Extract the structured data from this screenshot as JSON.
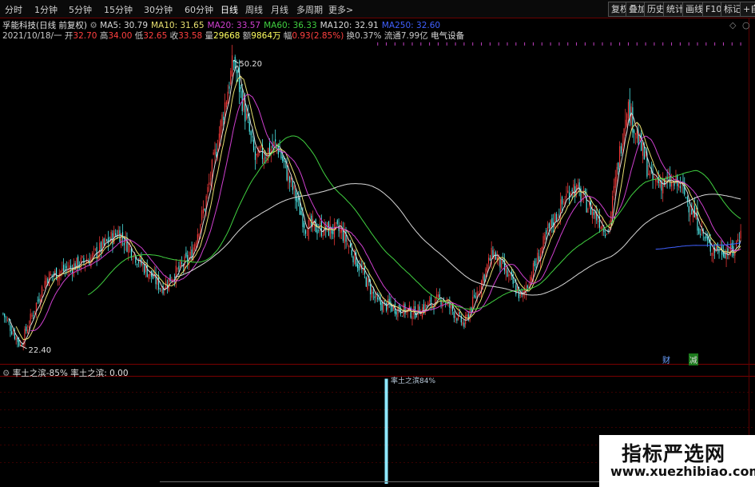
{
  "toolbar": {
    "periods": [
      "分时",
      "1分钟",
      "5分钟",
      "15分钟",
      "30分钟",
      "60分钟",
      "日线",
      "周线",
      "月线",
      "多周期",
      "更多>"
    ],
    "active_period": "日线",
    "right_buttons": [
      "复权",
      "叠加",
      "历史",
      "统计",
      "画线",
      "F10",
      "标记",
      "+自选"
    ]
  },
  "header": {
    "stock_title": "孚能科技(日线 前复权)",
    "ma_labels": [
      "MA5: 30.79",
      "MA10: 31.65",
      "MA20: 33.57",
      "MA60: 36.33",
      "MA120: 32.91",
      "MA250: 32.60"
    ],
    "ma_colors": [
      "#d8d8d8",
      "#e8e070",
      "#d040d0",
      "#40d040",
      "#d8d8d8",
      "#4060ff"
    ],
    "date": "2021/10/18/一",
    "open_label": "开",
    "open": "32.70",
    "high_label": "高",
    "high": "34.00",
    "low_label": "低",
    "low": "32.65",
    "close_label": "收",
    "close": "33.58",
    "volume_label": "量",
    "volume": "29668",
    "amount_label": "额",
    "amount": "9864万",
    "change_label": "幅",
    "change": "0.93(2.85%)",
    "turnover_label": "换",
    "turnover": "0.37%",
    "float_label": "流通",
    "float_cap": "7.99亿",
    "sector": "电气设备"
  },
  "price_annotations": {
    "high_label": "50.20",
    "low_label": "22.40"
  },
  "badges": {
    "cai": "财",
    "jian": "减"
  },
  "sub_chart": {
    "title": "率土之滨-85%",
    "value_label": "率土之滨: 0.00",
    "spike_label": "率土之滨84%"
  },
  "watermark": {
    "cn": "指标严选网",
    "url": "www.xuezhibiao.com"
  },
  "colors": {
    "up": "#ff3c3c",
    "down": "#54ffff",
    "background": "#000000",
    "grid": "#3a0000"
  },
  "chart_data": {
    "type": "candlestick",
    "ylim": [
      21,
      52
    ],
    "price_max": 50.2,
    "price_min": 22.4,
    "anchor_closes": [
      [
        0,
        25.5
      ],
      [
        12,
        22.4
      ],
      [
        30,
        29.0
      ],
      [
        60,
        30.8
      ],
      [
        80,
        33.5
      ],
      [
        95,
        30.5
      ],
      [
        110,
        28.0
      ],
      [
        130,
        31.0
      ],
      [
        140,
        36.0
      ],
      [
        160,
        50.2
      ],
      [
        175,
        40.5
      ],
      [
        190,
        42.0
      ],
      [
        210,
        34.0
      ],
      [
        235,
        33.5
      ],
      [
        260,
        26.5
      ],
      [
        285,
        25.6
      ],
      [
        305,
        27.0
      ],
      [
        320,
        24.4
      ],
      [
        340,
        31.5
      ],
      [
        360,
        27.0
      ],
      [
        380,
        34.0
      ],
      [
        395,
        38.0
      ],
      [
        420,
        33.5
      ],
      [
        433,
        46.0
      ],
      [
        450,
        38.5
      ],
      [
        470,
        38.0
      ],
      [
        490,
        32.0
      ],
      [
        507,
        31.5
      ],
      [
        512,
        33.58
      ]
    ],
    "ma_periods": [
      5,
      10,
      20,
      60,
      120,
      250
    ],
    "sub_values": {
      "spike_index": 266,
      "spike_value": 84
    }
  }
}
